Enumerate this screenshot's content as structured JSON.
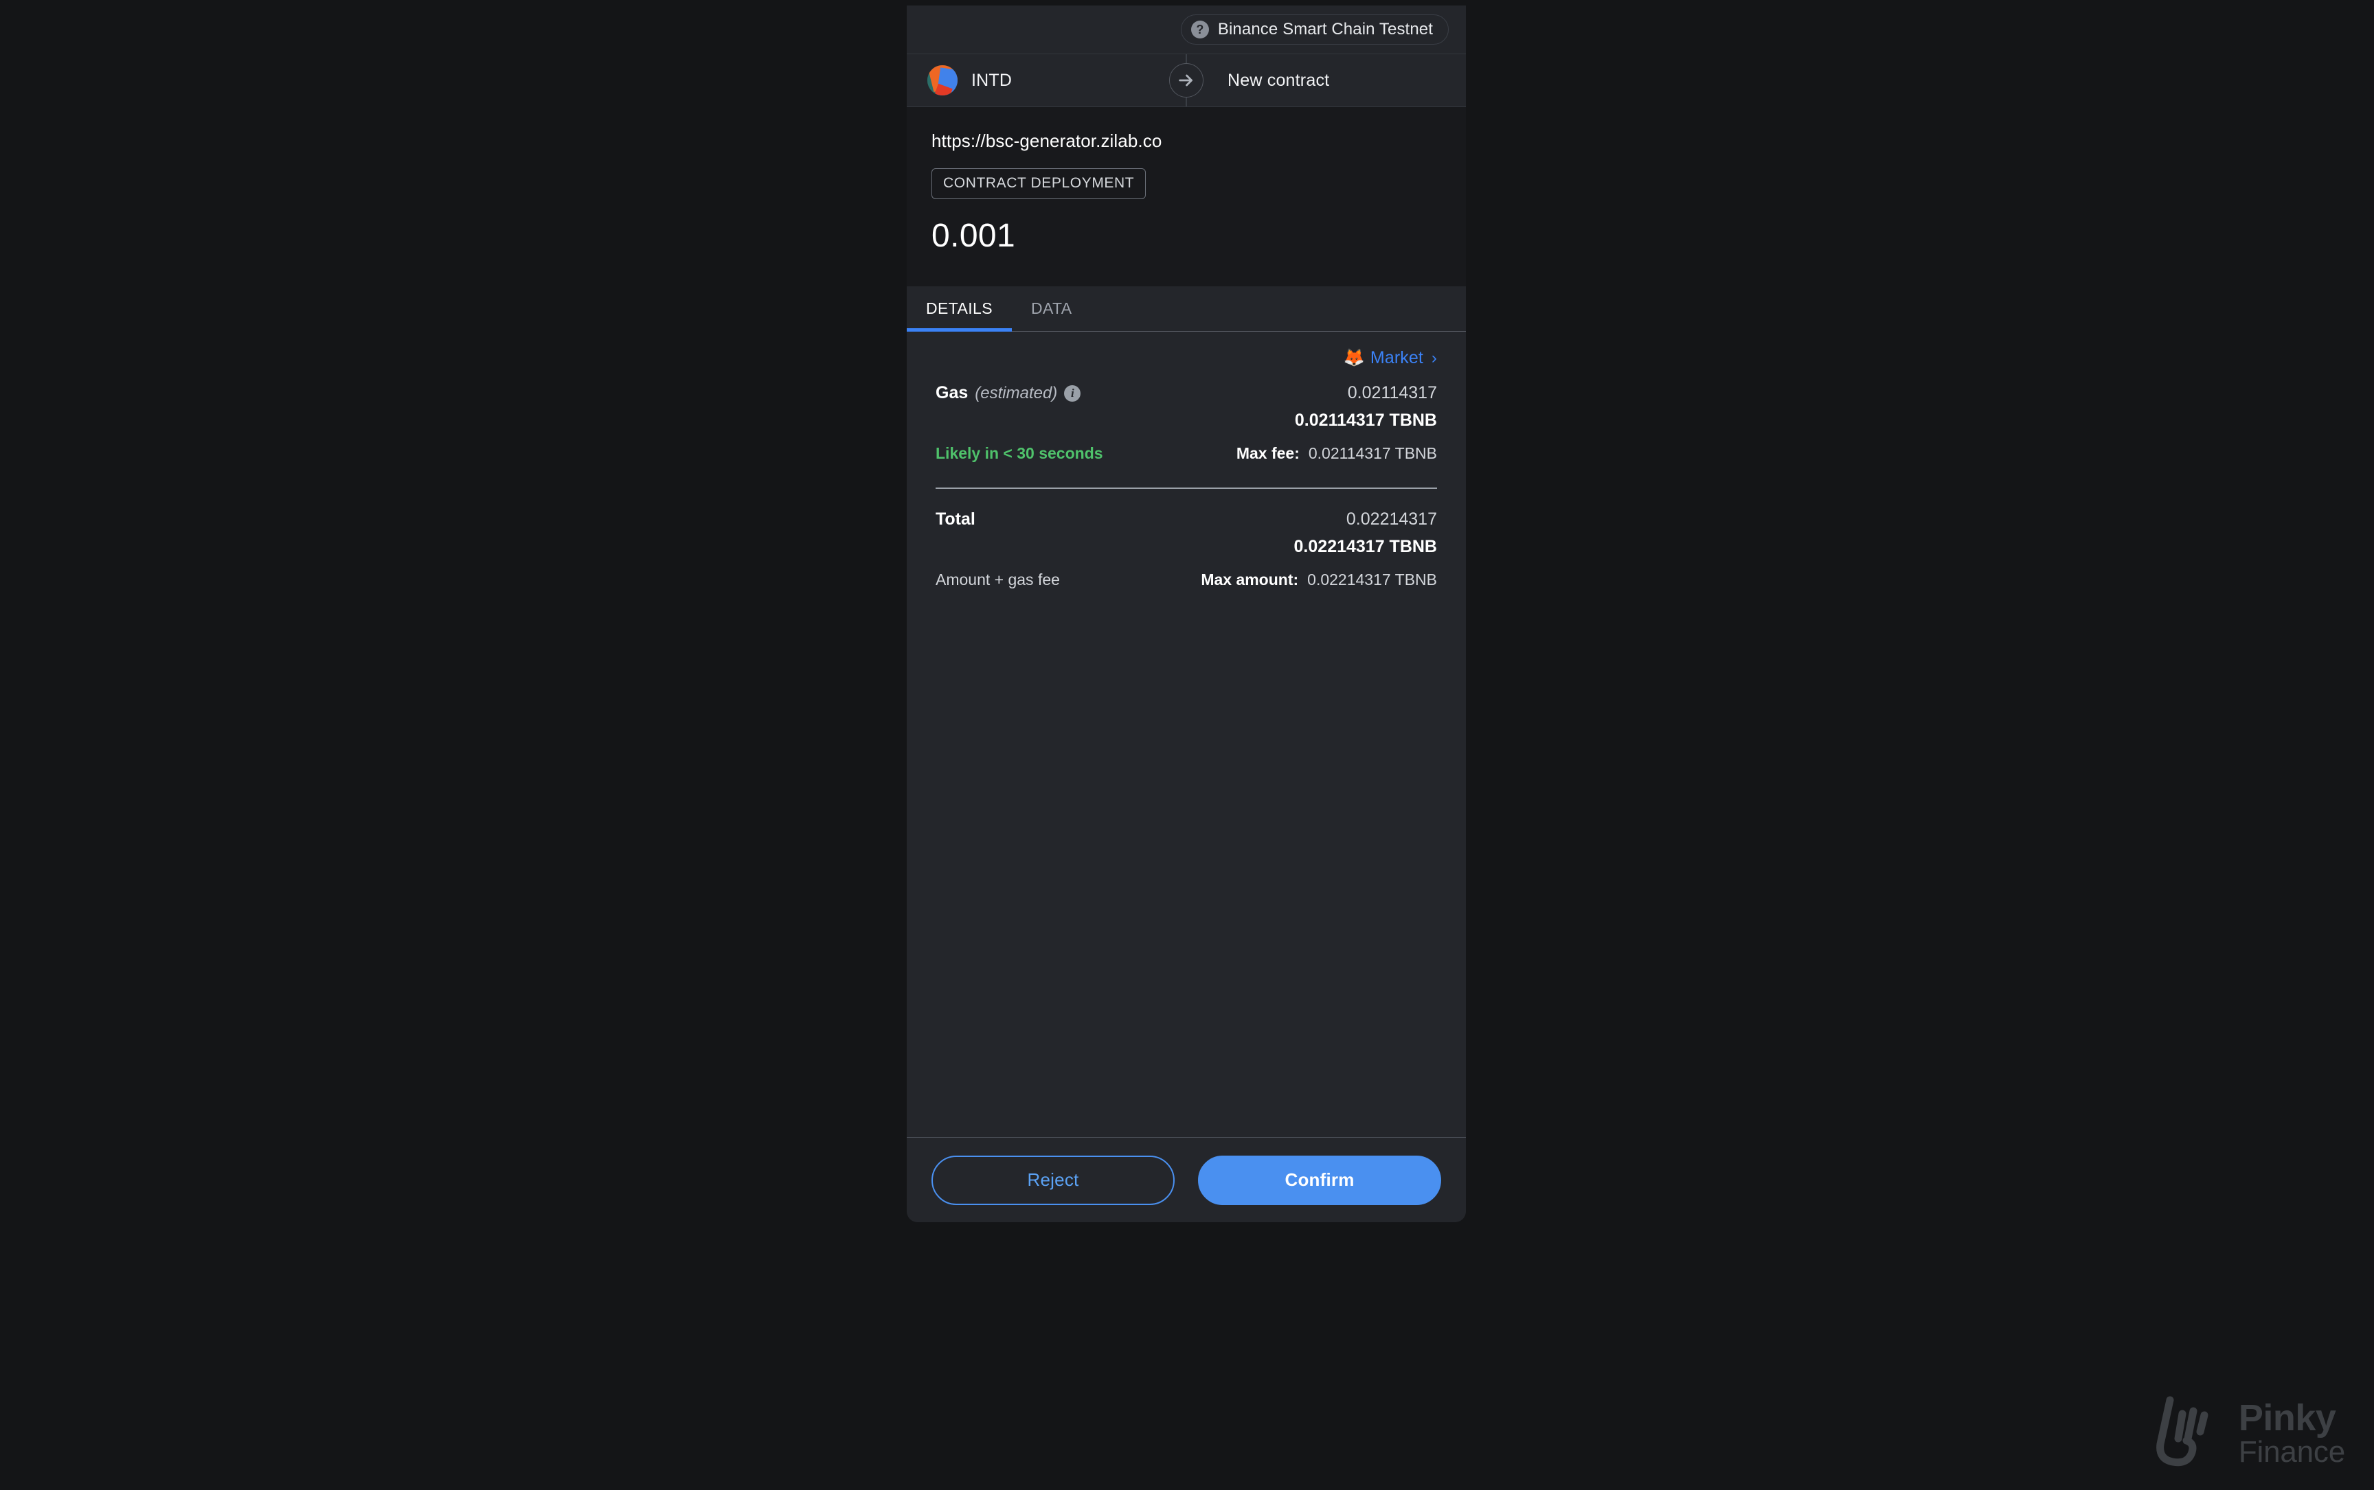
{
  "network": {
    "icon": "question-mark-icon",
    "name": "Binance Smart Chain Testnet"
  },
  "parties": {
    "sender_name": "INTD",
    "sender_avatar": "account-identicon",
    "arrow_icon": "arrow-right-icon",
    "recipient_name": "New contract"
  },
  "origin": {
    "url": "https://bsc-generator.zilab.co",
    "type_tag": "CONTRACT DEPLOYMENT",
    "amount": "0.001"
  },
  "tabs": [
    {
      "label": "DETAILS",
      "active": true
    },
    {
      "label": "DATA",
      "active": false
    }
  ],
  "details": {
    "market_link": {
      "emoji": "🦊",
      "label": "Market",
      "chevron": "›"
    },
    "gas": {
      "label": "Gas",
      "sublabel": "(estimated)",
      "info_icon": "info-icon",
      "fiat": "0.02114317",
      "native": "0.02114317 TBNB",
      "speed_text": "Likely in < 30 seconds",
      "max_fee_label": "Max fee:",
      "max_fee_value": "0.02114317 TBNB"
    },
    "total": {
      "label": "Total",
      "fiat": "0.02214317",
      "native": "0.02214317 TBNB",
      "note": "Amount + gas fee",
      "max_amount_label": "Max amount:",
      "max_amount_value": "0.02214317 TBNB"
    }
  },
  "footer": {
    "reject_label": "Reject",
    "confirm_label": "Confirm"
  },
  "watermark": {
    "line1": "Pinky",
    "line2": "Finance"
  },
  "colors": {
    "accent_blue": "#4a90f0",
    "link_blue": "#3b82f6",
    "success_green": "#4fc26b",
    "panel_bg": "#24262b",
    "panel_bg_dark": "#18191c",
    "page_bg": "#141517"
  }
}
